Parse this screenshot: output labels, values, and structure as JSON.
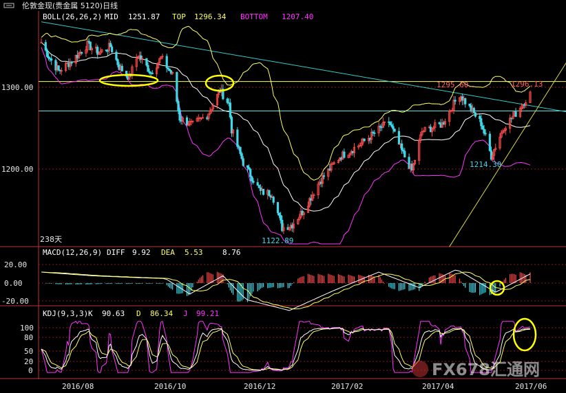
{
  "window": {
    "title": "伦敦金现(贵金属 5120)日线",
    "icon": "chart-window-icon"
  },
  "colors": {
    "background": "#000000",
    "up": "#ff4b4b",
    "down": "#3fd8e8",
    "mid": "#ffffff",
    "top": "#ffff66",
    "bottom": "#ff33ff",
    "axis": "#c03030",
    "grid": "#8a1a1a",
    "trend_cyan": "#33cccc",
    "trend_yellow": "#d8d840",
    "annotation": "#ffff00",
    "price_label_red": "#ff6060",
    "price_label_cyan": "#3fd8e8"
  },
  "chart_data": [
    {
      "type": "candlestick",
      "indicator": {
        "name": "BOLL(26,26,2)",
        "mid_label": "MID",
        "mid_value": "1251.87",
        "top_label": "TOP",
        "top_value": "1296.34",
        "bottom_label": "BOTTOM",
        "bottom_value": "1207.40"
      },
      "y_ticks": [
        "1300.00",
        "1200.00"
      ],
      "x_ticks": [
        "2016/08",
        "2016/10",
        "2016/12",
        "2017/02",
        "2017/04",
        "2017/06"
      ],
      "period_label": "238天",
      "price_annotations": [
        "1295.60",
        "1296.13",
        "1214.30",
        "1122.89"
      ],
      "anchors": [
        {
          "x": "2016/07/01",
          "y": 1355
        },
        {
          "x": "2016/07/06",
          "y": 1338
        },
        {
          "x": "2016/07/13",
          "y": 1320
        },
        {
          "x": "2016/07/22",
          "y": 1332
        },
        {
          "x": "2016/08/02",
          "y": 1352
        },
        {
          "x": "2016/08/10",
          "y": 1342
        },
        {
          "x": "2016/08/18",
          "y": 1350
        },
        {
          "x": "2016/08/24",
          "y": 1325
        },
        {
          "x": "2016/08/31",
          "y": 1312
        },
        {
          "x": "2016/09/06",
          "y": 1340
        },
        {
          "x": "2016/09/15",
          "y": 1318
        },
        {
          "x": "2016/09/22",
          "y": 1336
        },
        {
          "x": "2016/09/30",
          "y": 1315
        },
        {
          "x": "2016/10/05",
          "y": 1262
        },
        {
          "x": "2016/10/14",
          "y": 1254
        },
        {
          "x": "2016/10/24",
          "y": 1266
        },
        {
          "x": "2016/11/02",
          "y": 1296
        },
        {
          "x": "2016/11/08",
          "y": 1280
        },
        {
          "x": "2016/11/10",
          "y": 1248
        },
        {
          "x": "2016/11/18",
          "y": 1208
        },
        {
          "x": "2016/11/30",
          "y": 1172
        },
        {
          "x": "2016/12/08",
          "y": 1170
        },
        {
          "x": "2016/12/15",
          "y": 1128
        },
        {
          "x": "2016/12/22",
          "y": 1132
        },
        {
          "x": "2016/12/30",
          "y": 1150
        },
        {
          "x": "2017/01/10",
          "y": 1185
        },
        {
          "x": "2017/01/24",
          "y": 1215
        },
        {
          "x": "2017/02/07",
          "y": 1230
        },
        {
          "x": "2017/02/27",
          "y": 1258
        },
        {
          "x": "2017/03/08",
          "y": 1222
        },
        {
          "x": "2017/03/15",
          "y": 1198
        },
        {
          "x": "2017/03/22",
          "y": 1246
        },
        {
          "x": "2017/04/05",
          "y": 1255
        },
        {
          "x": "2017/04/17",
          "y": 1292
        },
        {
          "x": "2017/04/24",
          "y": 1275
        },
        {
          "x": "2017/05/02",
          "y": 1256
        },
        {
          "x": "2017/05/09",
          "y": 1216
        },
        {
          "x": "2017/05/18",
          "y": 1252
        },
        {
          "x": "2017/05/26",
          "y": 1268
        },
        {
          "x": "2017/06/05",
          "y": 1292
        }
      ],
      "horizontal_lines": [
        1307,
        1271
      ],
      "trendlines": [
        {
          "color": "cyan",
          "points": [
            {
              "x": "2016/07/01",
              "y": 1380
            },
            {
              "x": "2017/06/30",
              "y": 1270
            }
          ]
        },
        {
          "color": "yellow",
          "points": [
            {
              "x": "2017/04/10",
              "y": 1105
            },
            {
              "x": "2017/06/30",
              "y": 1330
            }
          ]
        }
      ]
    },
    {
      "type": "bar",
      "indicator": {
        "name": "MACD(12,26,9)",
        "diff_label": "DIFF",
        "diff_value": "9.92",
        "dea_label": "DEA",
        "dea_value": "5.53",
        "macd_value": "8.76"
      },
      "y_ticks": [
        "20.00",
        "0.00",
        "-20.00"
      ],
      "diff_anchors": [
        {
          "x": "2016/07/01",
          "y": 12
        },
        {
          "x": "2016/08/05",
          "y": 8
        },
        {
          "x": "2016/09/05",
          "y": 6
        },
        {
          "x": "2016/09/25",
          "y": 5
        },
        {
          "x": "2016/10/12",
          "y": -12
        },
        {
          "x": "2016/11/04",
          "y": 8
        },
        {
          "x": "2016/11/20",
          "y": -18
        },
        {
          "x": "2016/12/20",
          "y": -30
        },
        {
          "x": "2017/01/20",
          "y": -8
        },
        {
          "x": "2017/02/20",
          "y": 12
        },
        {
          "x": "2017/03/20",
          "y": -5
        },
        {
          "x": "2017/04/15",
          "y": 15
        },
        {
          "x": "2017/05/12",
          "y": -10
        },
        {
          "x": "2017/06/05",
          "y": 10
        }
      ]
    },
    {
      "type": "line",
      "indicator": {
        "name": "KDJ(9,3,3)",
        "k_label": "K",
        "k_value": "90.63",
        "d_label": "D",
        "d_value": "86.34",
        "j_label": "J",
        "j_value": "99.21"
      },
      "y_ticks": [
        "100",
        "80",
        "50",
        "20",
        "0"
      ]
    }
  ],
  "watermark": {
    "text": "FX678汇通网"
  }
}
